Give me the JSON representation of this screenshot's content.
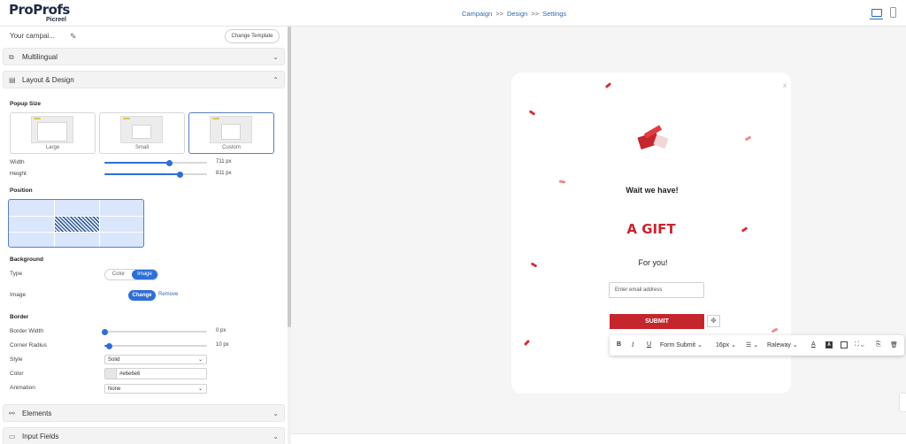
{
  "app": {
    "logo_main": "ProProfs",
    "logo_sub": "Picreel"
  },
  "breadcrumb": [
    "Campaign",
    "Design",
    "Settings"
  ],
  "breadcrumb_sep": ">>",
  "devices": {
    "desktop": "desktop-icon",
    "mobile": "mobile-icon",
    "active": "desktop"
  },
  "left": {
    "campaign_name": "Your campai...",
    "change_template": "Change Template",
    "sections": {
      "multilingual": "Multilingual",
      "layout": "Layout & Design",
      "elements": "Elements",
      "input_fields": "Input Fields"
    },
    "popup_size": {
      "title": "Popup Size",
      "options": [
        "Large",
        "Small",
        "Custom"
      ],
      "selected": "Custom"
    },
    "width_label": "Width",
    "width_value": "711 px",
    "width_level": 0.63,
    "height_label": "Height",
    "height_value": "811 px",
    "height_level": 0.74,
    "position_title": "Position",
    "position_selected": "center",
    "background": {
      "title": "Background",
      "type_label": "Type",
      "type_options": [
        "Color",
        "Image"
      ],
      "type_selected": "Image",
      "image_label": "Image",
      "change": "Change",
      "remove": "Remove"
    },
    "border": {
      "title": "Border",
      "width_label": "Border Width",
      "width_value": "0 px",
      "width_level": 0.0,
      "radius_label": "Corner Radius",
      "radius_value": "10 px",
      "radius_level": 0.05,
      "style_label": "Style",
      "style_value": "Solid",
      "color_label": "Color",
      "color_value": "#e6e6e6",
      "animation_label": "Animation",
      "animation_value": "None"
    }
  },
  "popup": {
    "heading": "Wait we have!",
    "big_text": "A GIFT",
    "sub_text": "For you!",
    "email_placeholder": "Enter email address",
    "submit": "SUBMIT",
    "close": "x",
    "accent": "#c5262e"
  },
  "toolbar": {
    "bold": "B",
    "italic": "I",
    "underline": "U",
    "element": "Form Submit",
    "font_size": "16px",
    "font": "Raleway",
    "chevron": "⌄"
  },
  "colors": {
    "primary": "#2e6fd6",
    "link": "#2d6ab3",
    "red": "#c5262e"
  }
}
